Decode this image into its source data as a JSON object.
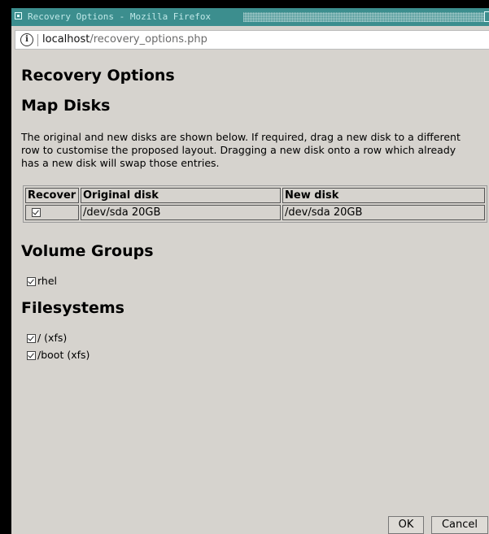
{
  "window": {
    "title": "Recovery Options - Mozilla Firefox"
  },
  "urlbar": {
    "host": "localhost",
    "path": "/recovery_options.php"
  },
  "page": {
    "heading": "Recovery Options",
    "map_disks": {
      "heading": "Map Disks",
      "intro": "The original and new disks are shown below. If required, drag a new disk to a different row to customise the proposed layout. Dragging a new disk onto a row which already has a new disk will swap those entries.",
      "columns": [
        "Recover",
        "Original disk",
        "New disk"
      ],
      "rows": [
        {
          "recover": true,
          "original": "/dev/sda 20GB",
          "new": "/dev/sda 20GB"
        }
      ]
    },
    "volume_groups": {
      "heading": "Volume Groups",
      "items": [
        {
          "label": "rhel",
          "checked": true
        }
      ]
    },
    "filesystems": {
      "heading": "Filesystems",
      "items": [
        {
          "label": "/ (xfs)",
          "checked": true
        },
        {
          "label": "/boot (xfs)",
          "checked": true
        }
      ]
    }
  },
  "buttons": {
    "ok": "OK",
    "cancel": "Cancel"
  },
  "icons": {
    "window_icon": "window-menu-icon",
    "info_icon": "site-info-icon",
    "checkbox": "checkbox-checked-icon"
  },
  "colors": {
    "titlebar": "#3c8e8e",
    "titlebar_text": "#bfe8e8",
    "background": "#d6d3ce"
  }
}
